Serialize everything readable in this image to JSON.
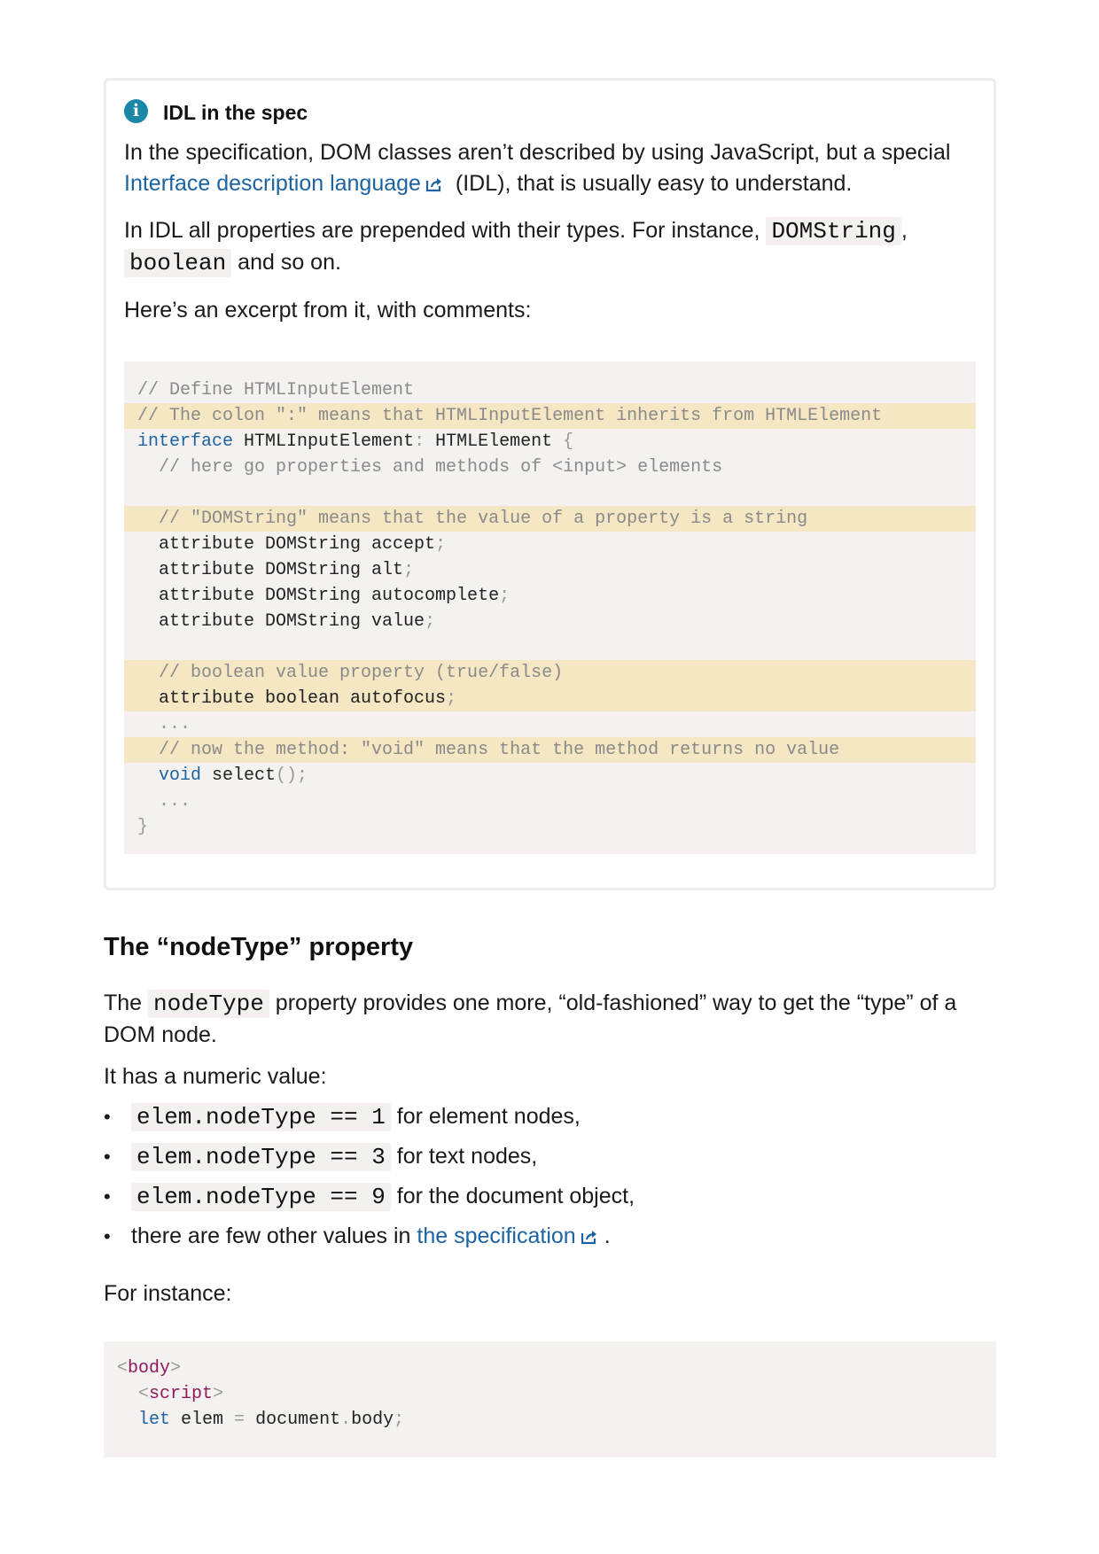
{
  "info": {
    "title": "IDL in the spec",
    "icon": "info-icon",
    "p1_before": "In the specification, DOM classes aren’t described by using JavaScript, but a special ",
    "p1_link": "Interface description language",
    "p1_after": " (IDL), that is usually easy to understand.",
    "p2_before": "In IDL all properties are prepended with their types. For instance, ",
    "p2_code1": "DOMString",
    "p2_mid": ", ",
    "p2_code2": "boolean",
    "p2_after": " and so on.",
    "p3": "Here’s an excerpt from it, with comments:",
    "code": [
      {
        "hl": false,
        "tokens": [
          {
            "t": "// Define HTMLInputElement",
            "c": "comment"
          }
        ]
      },
      {
        "hl": true,
        "tokens": [
          {
            "t": "// The colon \":\" means that HTMLInputElement inherits from HTMLElement",
            "c": "comment"
          }
        ]
      },
      {
        "hl": false,
        "tokens": [
          {
            "t": "interface",
            "c": "kw"
          },
          {
            "t": " HTMLInputElement",
            "c": ""
          },
          {
            "t": ":",
            "c": "punct"
          },
          {
            "t": " HTMLElement ",
            "c": ""
          },
          {
            "t": "{",
            "c": "punct"
          }
        ]
      },
      {
        "hl": false,
        "tokens": [
          {
            "t": "  // here go properties and methods of <input> elements",
            "c": "comment"
          }
        ]
      },
      {
        "hl": false,
        "tokens": [
          {
            "t": "",
            "c": ""
          }
        ]
      },
      {
        "hl": true,
        "tokens": [
          {
            "t": "  // \"DOMString\" means that the value of a property is a string",
            "c": "comment"
          }
        ]
      },
      {
        "hl": false,
        "tokens": [
          {
            "t": "  attribute DOMString accept",
            "c": ""
          },
          {
            "t": ";",
            "c": "punct"
          }
        ]
      },
      {
        "hl": false,
        "tokens": [
          {
            "t": "  attribute DOMString alt",
            "c": ""
          },
          {
            "t": ";",
            "c": "punct"
          }
        ]
      },
      {
        "hl": false,
        "tokens": [
          {
            "t": "  attribute DOMString autocomplete",
            "c": ""
          },
          {
            "t": ";",
            "c": "punct"
          }
        ]
      },
      {
        "hl": false,
        "tokens": [
          {
            "t": "  attribute DOMString value",
            "c": ""
          },
          {
            "t": ";",
            "c": "punct"
          }
        ]
      },
      {
        "hl": false,
        "tokens": [
          {
            "t": "",
            "c": ""
          }
        ]
      },
      {
        "hl": true,
        "tokens": [
          {
            "t": "  // boolean value property (true/false)",
            "c": "comment"
          }
        ]
      },
      {
        "hl": true,
        "tokens": [
          {
            "t": "  attribute boolean autofocus",
            "c": ""
          },
          {
            "t": ";",
            "c": "punct"
          }
        ]
      },
      {
        "hl": false,
        "tokens": [
          {
            "t": "  ...",
            "c": "punct"
          }
        ]
      },
      {
        "hl": true,
        "tokens": [
          {
            "t": "  // now the method: \"void\" means that the method returns no value",
            "c": "comment"
          }
        ]
      },
      {
        "hl": false,
        "tokens": [
          {
            "t": "  ",
            "c": ""
          },
          {
            "t": "void",
            "c": "kw"
          },
          {
            "t": " select",
            "c": ""
          },
          {
            "t": "();",
            "c": "punct"
          }
        ]
      },
      {
        "hl": false,
        "tokens": [
          {
            "t": "  ...",
            "c": "punct"
          }
        ]
      },
      {
        "hl": false,
        "tokens": [
          {
            "t": "}",
            "c": "punct"
          }
        ]
      }
    ]
  },
  "section": {
    "title": "The “nodeType” property",
    "p1_before": "The ",
    "p1_code": "nodeType",
    "p1_after": " property provides one more, “old-fashioned” way to get the “type” of a DOM node.",
    "p2": "It has a numeric value:",
    "bullet_glyph": "•",
    "bullets": [
      {
        "code": "elem.nodeType == 1",
        "text": " for element nodes,"
      },
      {
        "code": "elem.nodeType == 3",
        "text": " for text nodes,"
      },
      {
        "code": "elem.nodeType == 9",
        "text": " for the document object,"
      }
    ],
    "bullet4_before": "there are few other values in ",
    "bullet4_link": "the specification",
    "bullet4_after": ".",
    "p3": "For instance:",
    "code": [
      {
        "tokens": [
          {
            "t": "<",
            "c": "punct"
          },
          {
            "t": "body",
            "c": "tag"
          },
          {
            "t": ">",
            "c": "punct"
          }
        ]
      },
      {
        "tokens": [
          {
            "t": "  ",
            "c": ""
          },
          {
            "t": "<",
            "c": "punct"
          },
          {
            "t": "script",
            "c": "tag"
          },
          {
            "t": ">",
            "c": "punct"
          }
        ]
      },
      {
        "tokens": [
          {
            "t": "  ",
            "c": ""
          },
          {
            "t": "let",
            "c": "kw"
          },
          {
            "t": " elem ",
            "c": ""
          },
          {
            "t": "=",
            "c": "punct"
          },
          {
            "t": " document",
            "c": ""
          },
          {
            "t": ".",
            "c": "punct"
          },
          {
            "t": "body",
            "c": ""
          },
          {
            "t": ";",
            "c": "punct"
          }
        ]
      }
    ]
  }
}
